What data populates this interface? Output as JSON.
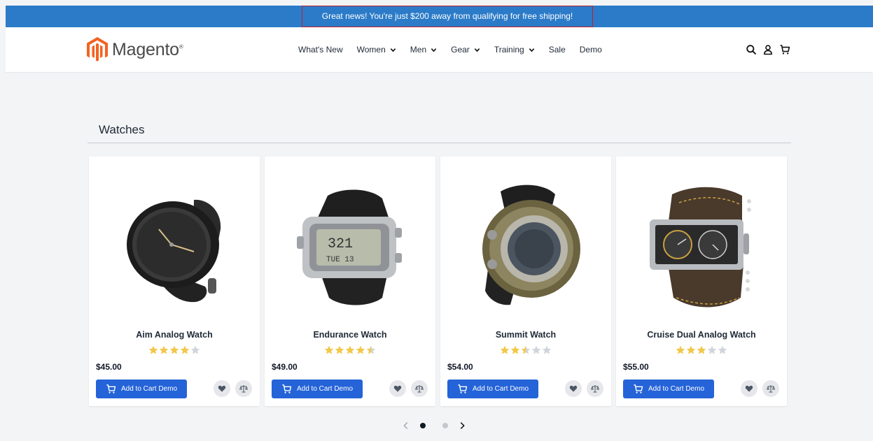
{
  "promo": {
    "text": "Great news! You're just $200 away from qualifying for free shipping!"
  },
  "header": {
    "logo_text": "Magento",
    "logo_mark": "®",
    "nav": [
      {
        "label": "What's New",
        "dropdown": false
      },
      {
        "label": "Women",
        "dropdown": true
      },
      {
        "label": "Men",
        "dropdown": true
      },
      {
        "label": "Gear",
        "dropdown": true
      },
      {
        "label": "Training",
        "dropdown": true
      },
      {
        "label": "Sale",
        "dropdown": false
      },
      {
        "label": "Demo",
        "dropdown": false
      }
    ],
    "icons": [
      "search-icon",
      "account-icon",
      "cart-icon"
    ]
  },
  "section": {
    "title": "Watches"
  },
  "products": [
    {
      "name": "Aim Analog Watch",
      "price": "$45.00",
      "rating": 4,
      "cart_label": "Add to Cart Demo"
    },
    {
      "name": "Endurance Watch",
      "price": "$49.00",
      "rating": 4.5,
      "cart_label": "Add to Cart Demo"
    },
    {
      "name": "Summit Watch",
      "price": "$54.00",
      "rating": 2.5,
      "cart_label": "Add to Cart Demo"
    },
    {
      "name": "Cruise Dual Analog Watch",
      "price": "$55.00",
      "rating": 3,
      "cart_label": "Add to Cart Demo"
    }
  ],
  "pager": {
    "pages": 2,
    "active": 1
  },
  "colors": {
    "promo_bg": "#2b7bc8",
    "primary": "#2563d8",
    "star": "#f2c84b",
    "star_empty": "#d1d5db",
    "logo": "#f26322"
  }
}
